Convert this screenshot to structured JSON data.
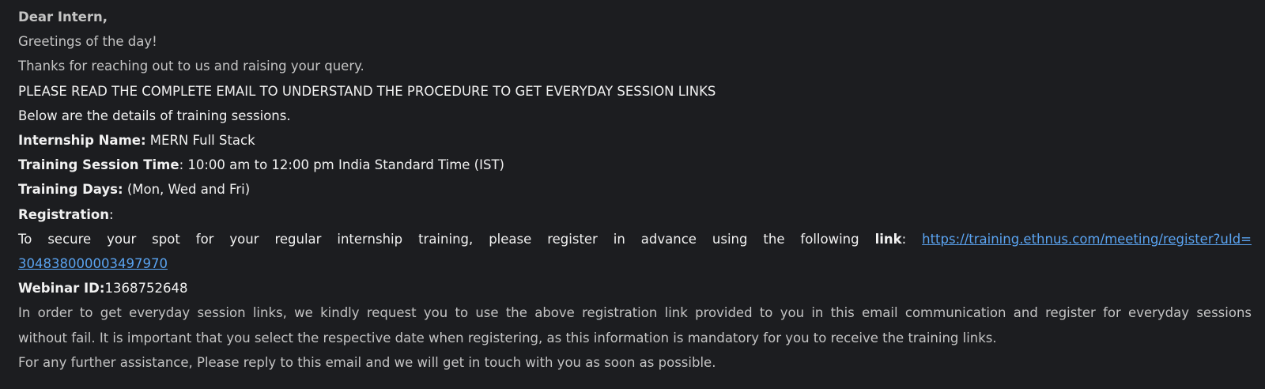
{
  "email": {
    "salutation": "Dear Intern,",
    "greeting": "Greetings of the day!",
    "thanks": "Thanks for reaching out to us and raising your query.",
    "notice": "PLEASE READ THE COMPLETE EMAIL TO UNDERSTAND THE PROCEDURE TO GET EVERYDAY SESSION LINKS",
    "intro": "Below are the details of training sessions.",
    "internship": {
      "label": "Internship Name:",
      "value": " MERN Full Stack"
    },
    "session_time": {
      "label": "Training Session Time",
      "value": ": 10:00 am to 12:00 pm India Standard Time (IST)"
    },
    "training_days": {
      "label": "Training Days:",
      "value": " (Mon, Wed and Fri)"
    },
    "registration": {
      "label": "Registration",
      "suffix": ":",
      "text_before": "To secure your spot for your regular internship training, please register in advance using the following ",
      "link_word": "link",
      "colon": ": ",
      "url_line1": "https://training.ethnus.com/meeting/register?uId=",
      "url_line2": "304838000003497970",
      "href": "https://training.ethnus.com/meeting/register?uId=304838000003497970"
    },
    "webinar": {
      "label": "Webinar ID:",
      "value": "1368752648"
    },
    "instructions_line1": "In order to get everyday session links, we kindly request you to use the above registration link provided to you in this email communication and register for everyday sessions",
    "instructions_line2": "without fail. It is important that you select the respective date when registering, as this information is mandatory for you to receive the training links.",
    "closing": "For any further assistance, Please reply to this email and we will get in touch with you as soon as possible."
  }
}
